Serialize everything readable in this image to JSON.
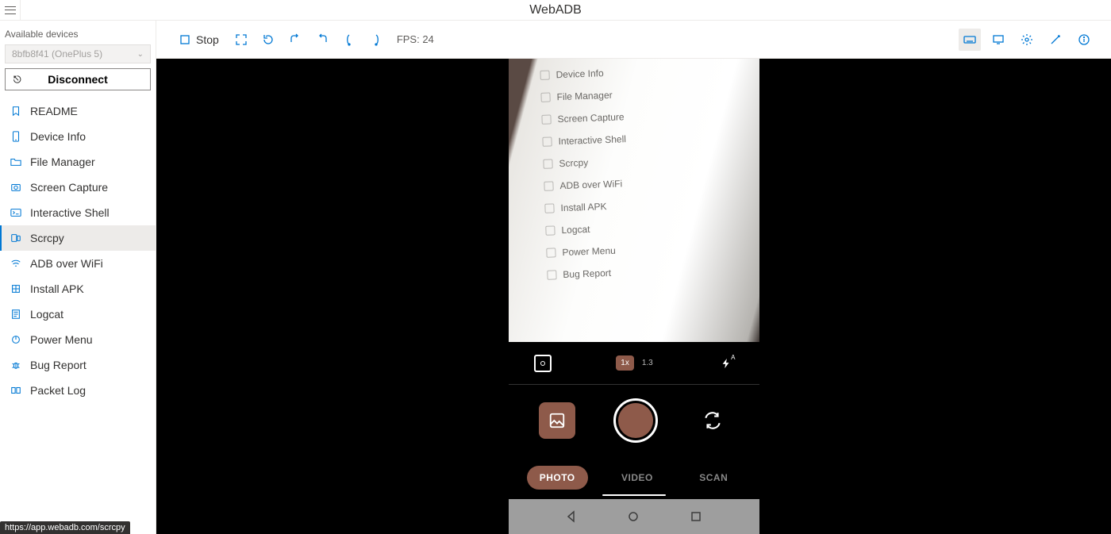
{
  "app": {
    "title": "WebADB"
  },
  "sidebar": {
    "heading": "Available devices",
    "device_selected": "8bfb8f41 (OnePlus 5)",
    "disconnect_label": "Disconnect",
    "items": [
      {
        "label": "README",
        "icon": "bookmark-icon"
      },
      {
        "label": "Device Info",
        "icon": "phone-icon"
      },
      {
        "label": "File Manager",
        "icon": "folder-icon"
      },
      {
        "label": "Screen Capture",
        "icon": "camera-icon"
      },
      {
        "label": "Interactive Shell",
        "icon": "terminal-icon"
      },
      {
        "label": "Scrcpy",
        "icon": "mirror-icon",
        "active": true
      },
      {
        "label": "ADB over WiFi",
        "icon": "wifi-icon"
      },
      {
        "label": "Install APK",
        "icon": "package-icon"
      },
      {
        "label": "Logcat",
        "icon": "log-icon"
      },
      {
        "label": "Power Menu",
        "icon": "power-icon"
      },
      {
        "label": "Bug Report",
        "icon": "bug-icon"
      },
      {
        "label": "Packet Log",
        "icon": "packet-icon"
      }
    ]
  },
  "toolbar": {
    "stop_label": "Stop",
    "fps_label": "FPS: 24"
  },
  "phone": {
    "preview_items": [
      "Device Info",
      "File Manager",
      "Screen Capture",
      "Interactive Shell",
      "Scrcpy",
      "ADB over WiFi",
      "Install APK",
      "Logcat",
      "Power Menu",
      "Bug Report"
    ],
    "zoom_active": "1x",
    "zoom_alt": "1.3",
    "flash_mode": "A",
    "modes": {
      "photo": "PHOTO",
      "video": "VIDEO",
      "scan": "SCAN"
    }
  },
  "status_url": "https://app.webadb.com/scrcpy"
}
